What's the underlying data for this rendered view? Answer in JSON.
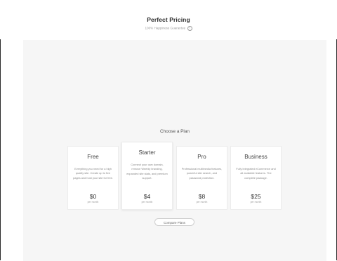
{
  "header": {
    "title": "Perfect Pricing",
    "subtitle": "100% Happiness Guarantee",
    "help_icon": "?"
  },
  "section_title": "Choose a Plan",
  "plans": [
    {
      "name": "Free",
      "description": "Everything you need for a high quality site. Create up to five pages and host your site for free.",
      "price": "$0",
      "period": "per month"
    },
    {
      "name": "Starter",
      "description": "Connect your own domain, remove Weebly branding, expanded site stats, and premium support.",
      "price": "$4",
      "period": "per month"
    },
    {
      "name": "Pro",
      "description": "Professional multimedia features, powerful site search, and password protection.",
      "price": "$8",
      "period": "per month"
    },
    {
      "name": "Business",
      "description": "Fully integrated eCommerce and all available features. The complete package.",
      "price": "$25",
      "period": "per month"
    }
  ],
  "compare_button": "Compare Plans"
}
